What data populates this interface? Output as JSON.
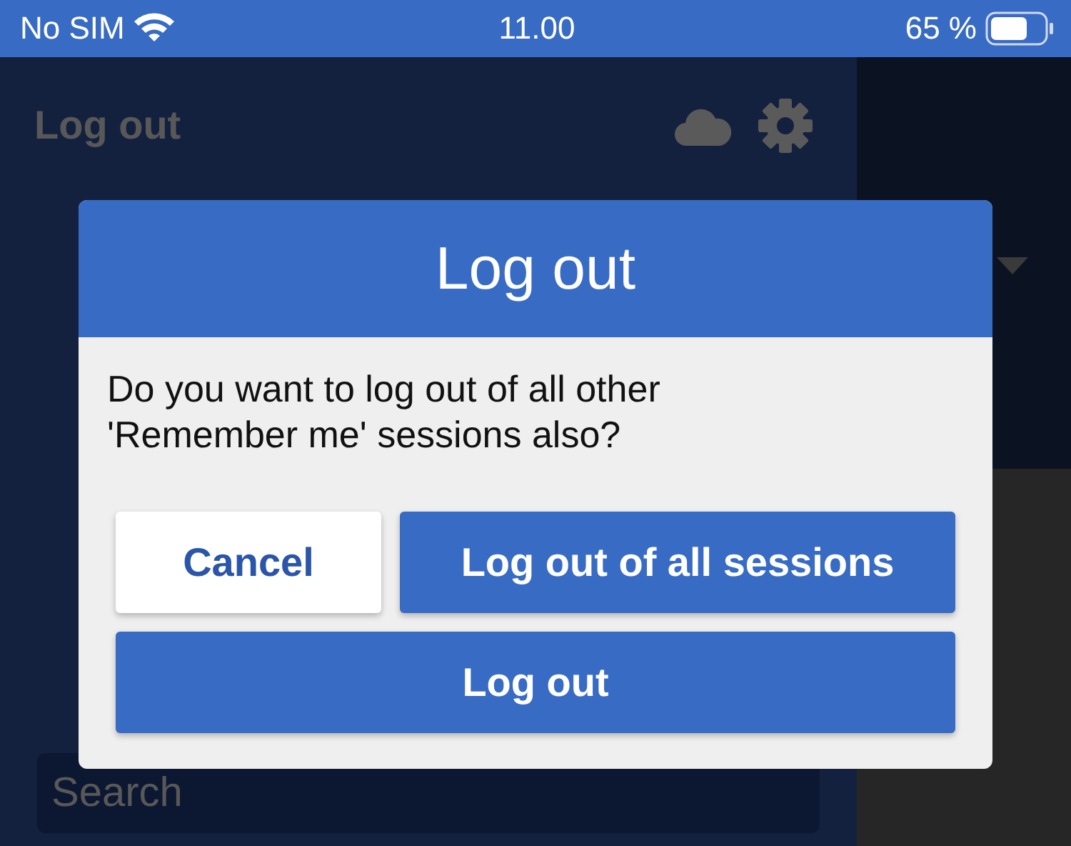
{
  "status_bar": {
    "carrier": "No SIM",
    "time": "11.00",
    "battery": "65 %"
  },
  "panel": {
    "title": "Log out",
    "search": {
      "placeholder": "Search"
    }
  },
  "dialog": {
    "title": "Log out",
    "message": "Do you want to log out of all other 'Remember me' sessions also?",
    "buttons": [
      {
        "label": "Cancel",
        "kind": "secondary"
      },
      {
        "label": "Log out of all sessions",
        "kind": "primary"
      },
      {
        "label": "Log out",
        "kind": "primary"
      }
    ]
  }
}
